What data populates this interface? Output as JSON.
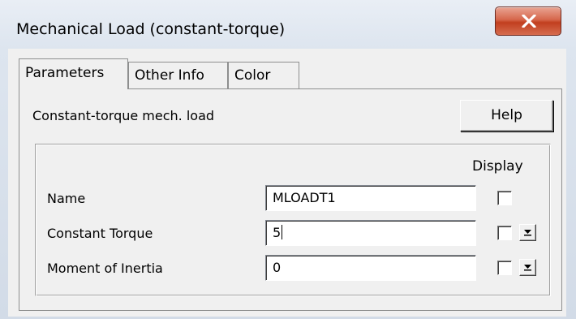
{
  "window": {
    "title": "Mechanical Load (constant-torque)",
    "close_icon": "close-x-icon"
  },
  "tabs": [
    {
      "label": "Parameters",
      "active": true
    },
    {
      "label": "Other Info",
      "active": false
    },
    {
      "label": "Color",
      "active": false
    }
  ],
  "panel": {
    "description": "Constant-torque mech. load",
    "help_label": "Help",
    "display_header": "Display"
  },
  "params": [
    {
      "label": "Name",
      "value": "MLOADT1",
      "display_checked": false,
      "has_dropdown": false
    },
    {
      "label": "Constant Torque",
      "value": "5",
      "display_checked": false,
      "has_dropdown": true
    },
    {
      "label": "Moment of Inertia",
      "value": "0",
      "display_checked": false,
      "has_dropdown": true
    }
  ],
  "colors": {
    "close_button": "#c8452a",
    "dialog_face": "#f0f0f0"
  }
}
